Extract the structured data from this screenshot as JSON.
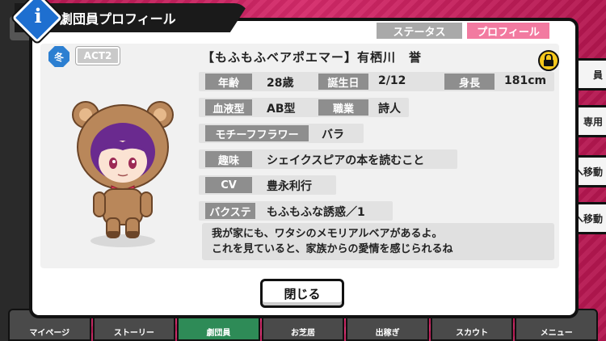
{
  "dialog": {
    "title": "劇団員プロフィール",
    "tabs": {
      "status": "ステータス",
      "profile": "プロフィール"
    },
    "season_badge": "冬",
    "act_badge": "ACT2",
    "character_name": "【もふもふベアポエマー】有栖川　誉",
    "fields": {
      "age_label": "年齢",
      "age_value": "28歳",
      "birthday_label": "誕生日",
      "birthday_value": "2/12",
      "height_label": "身長",
      "height_value": "181cm",
      "blood_label": "血液型",
      "blood_value": "AB型",
      "job_label": "職業",
      "job_value": "詩人",
      "flower_label": "モチーフフラワー",
      "flower_value": "バラ",
      "hobby_label": "趣味",
      "hobby_value": "シェイクスピアの本を読むこと",
      "cv_label": "CV",
      "cv_value": "豊永利行",
      "buff_label": "バクステ",
      "buff_value": "もふもふな誘惑／1"
    },
    "description_line1": "我が家にも、ワタシのメモリアルベアがあるよ。",
    "description_line2": "これを見ていると、家族からの愛情を感じられるね",
    "close_label": "閉じる"
  },
  "side_buttons": [
    "員",
    "専用",
    "へ移動",
    "へ移動"
  ],
  "bottom_nav": [
    "マイページ",
    "ストーリー",
    "劇団員",
    "お芝居",
    "出稼ぎ",
    "スカウト",
    "メニュー"
  ],
  "colors": {
    "accent_pink": "#f27aa0",
    "info_blue": "#1e6fd0",
    "lock_yellow": "#f6c81c"
  }
}
